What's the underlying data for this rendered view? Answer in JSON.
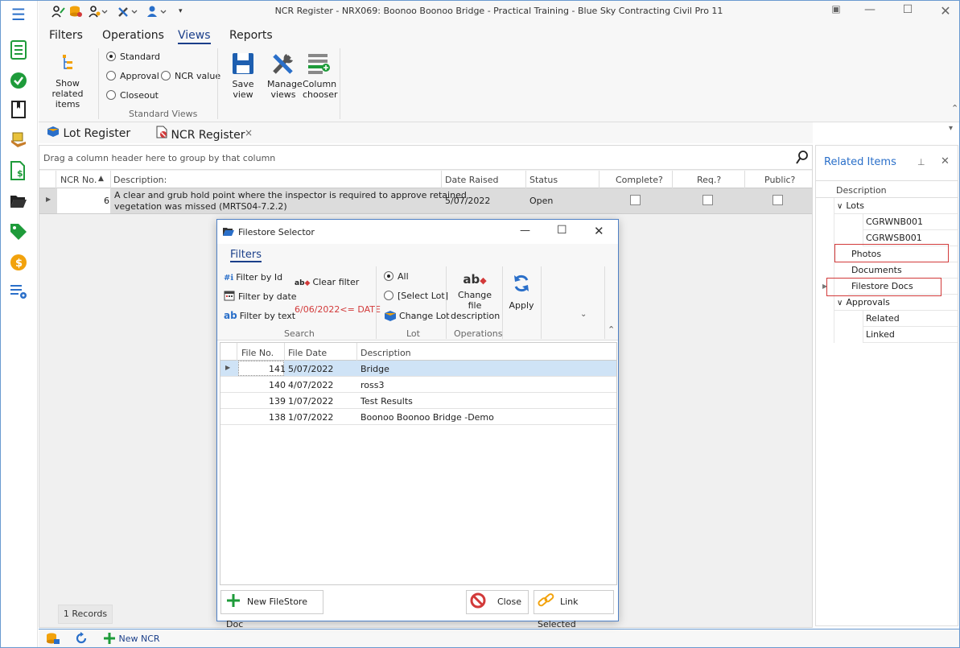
{
  "window": {
    "title": "NCR Register - NRX069: Boonoo Boonoo Bridge - Practical Training - Blue Sky Contracting Civil Pro 11"
  },
  "ribbon": {
    "tabs": [
      {
        "label": "Filters"
      },
      {
        "label": "Operations"
      },
      {
        "label": "Views"
      },
      {
        "label": "Reports"
      }
    ],
    "show_related": "Show related items",
    "view_options": {
      "standard": "Standard",
      "approval": "Approval",
      "ncr_value": "NCR value",
      "closeout": "Closeout"
    },
    "group_label": "Standard Views",
    "save_view": "Save view",
    "manage_views": "Manage views",
    "column_chooser": "Column chooser"
  },
  "doc_tabs": {
    "lot_register": "Lot Register",
    "ncr_register": "NCR Register",
    "close": "×"
  },
  "grid": {
    "group_hint": "Drag a column header here to group by that column",
    "columns": {
      "ncr_no": "NCR No.",
      "description": "Description:",
      "date_raised": "Date Raised",
      "status": "Status",
      "complete": "Complete?",
      "req": "Req.?",
      "public": "Public?"
    },
    "row": {
      "ncr_no": "6",
      "description_line1": "A clear and grub hold point where the inspector is required to approve retained",
      "description_line2": "vegetation was missed (MRTS04-7.2.2)",
      "date_raised": "5/07/2022",
      "status": "Open"
    },
    "records": "1 Records"
  },
  "related": {
    "title": "Related Items",
    "column": "Description",
    "items": {
      "lots": "Lots",
      "lot1": "CGRWNB001",
      "lot2": "CGRWSB001",
      "photos": "Photos",
      "documents": "Documents",
      "filestore": "Filestore Docs",
      "approvals": "Approvals",
      "related": "Related",
      "linked": "Linked"
    }
  },
  "statusbar": {
    "new_ncr": "New NCR"
  },
  "dialog": {
    "title": "Filestore Selector",
    "tab": "Filters",
    "filter_by_id": "Filter by Id",
    "filter_by_date": "Filter by date",
    "filter_by_text": "Filter by text",
    "clear_filter": "Clear filter",
    "date_filter": "6/06/2022<= DATE",
    "search_group": "Search",
    "all": "All",
    "select_lot": "[Select Lot]",
    "change_lot": "Change Lot",
    "lot_group": "Lot",
    "change_desc": "Change file description",
    "apply": "Apply",
    "ops_group": "Operations",
    "columns": {
      "file_no": "File No.",
      "file_date": "File Date",
      "description": "Description"
    },
    "rows": [
      {
        "file_no": "141",
        "file_date": "5/07/2022",
        "description": "Bridge"
      },
      {
        "file_no": "140",
        "file_date": "4/07/2022",
        "description": "ross3"
      },
      {
        "file_no": "139",
        "file_date": "1/07/2022",
        "description": "Test Results"
      },
      {
        "file_no": "138",
        "file_date": "1/07/2022",
        "description": "Boonoo Boonoo Bridge -Demo"
      }
    ],
    "new_doc": "New FileStore Doc",
    "close": "Close",
    "link_selected": "Link Selected"
  },
  "colors": {
    "accent": "#1b3f8a",
    "link_blue": "#2a6fc9",
    "highlight_red": "#d23a3a",
    "green": "#1e9b3a"
  }
}
